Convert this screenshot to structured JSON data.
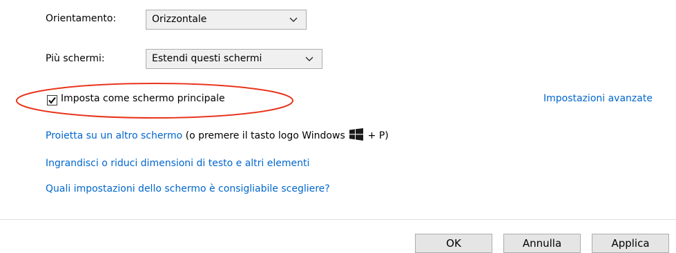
{
  "orientation": {
    "label": "Orientamento:",
    "value": "Orizzontale"
  },
  "multiple_displays": {
    "label": "Più schermi:",
    "value": "Estendi questi schermi"
  },
  "main_display": {
    "label": "Imposta come schermo principale",
    "checked": true
  },
  "advanced_link": "Impostazioni avanzate",
  "project_row": {
    "link": "Proietta su un altro schermo",
    "suffix_before_logo": "(o premere il tasto logo Windows",
    "suffix_after_logo": "+ P)"
  },
  "text_size_link": "Ingrandisci o riduci dimensioni di testo e altri elementi",
  "which_settings_link": "Quali impostazioni dello schermo è consigliabile scegliere?",
  "buttons": {
    "ok": "OK",
    "cancel": "Annulla",
    "apply": "Applica"
  },
  "colors": {
    "link": "#0066cc",
    "highlight_ellipse": "#e8341c"
  },
  "icons": [
    "chevron-down-icon",
    "checkmark-icon",
    "windows-logo-icon"
  ]
}
